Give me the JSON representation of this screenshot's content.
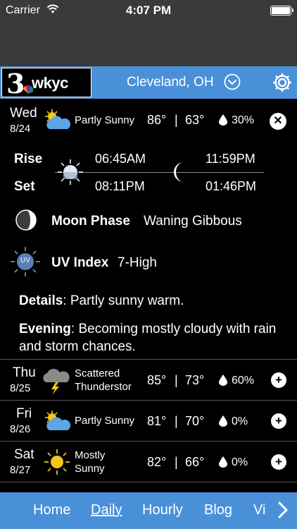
{
  "status_bar": {
    "carrier": "Carrier",
    "time": "4:07 PM"
  },
  "header": {
    "logo_number": "3",
    "logo_text": "wkyc",
    "city": "Cleveland, OH"
  },
  "today": {
    "day": "Wed",
    "date": "8/24",
    "condition": "Partly Sunny",
    "high": "86°",
    "separator": "|",
    "low": "63°",
    "precip": "30%",
    "close_label": "✕",
    "rise_label": "Rise",
    "set_label": "Set",
    "sunrise": "06:45AM",
    "sunset": "08:11PM",
    "moonrise": "11:59PM",
    "moonset": "01:46PM",
    "moon_phase_label": "Moon Phase",
    "moon_phase_value": "Waning Gibbous",
    "uv_icon_text": "UV",
    "uv_label": "UV Index",
    "uv_value": "7-High",
    "details_label": "Details",
    "details_text": ": Partly sunny  warm.",
    "evening_label": "Evening",
    "evening_text": ": Becoming mostly cloudy with rain and storm chances."
  },
  "forecast": [
    {
      "day": "Thu",
      "date": "8/25",
      "condition_line1": "Scattered",
      "condition_line2": "Thunderstor",
      "high": "85°",
      "low": "73°",
      "precip": "60%",
      "icon": "thunderstorm-icon"
    },
    {
      "day": "Fri",
      "date": "8/26",
      "condition_line1": "Partly Sunny",
      "condition_line2": "",
      "high": "81°",
      "low": "70°",
      "precip": "0%",
      "icon": "partly-sunny-icon"
    },
    {
      "day": "Sat",
      "date": "8/27",
      "condition_line1": "Mostly",
      "condition_line2": "Sunny",
      "high": "82°",
      "low": "66°",
      "precip": "0%",
      "icon": "sunny-icon"
    }
  ],
  "plus_label": "+",
  "nav": {
    "home": "Home",
    "daily": "Daily",
    "hourly": "Hourly",
    "blog": "Blog",
    "video": "Vi"
  },
  "colors": {
    "accent": "#4a90d9",
    "background": "#000000",
    "status_bar": "#3a3a3a",
    "sun": "#f5c518"
  }
}
